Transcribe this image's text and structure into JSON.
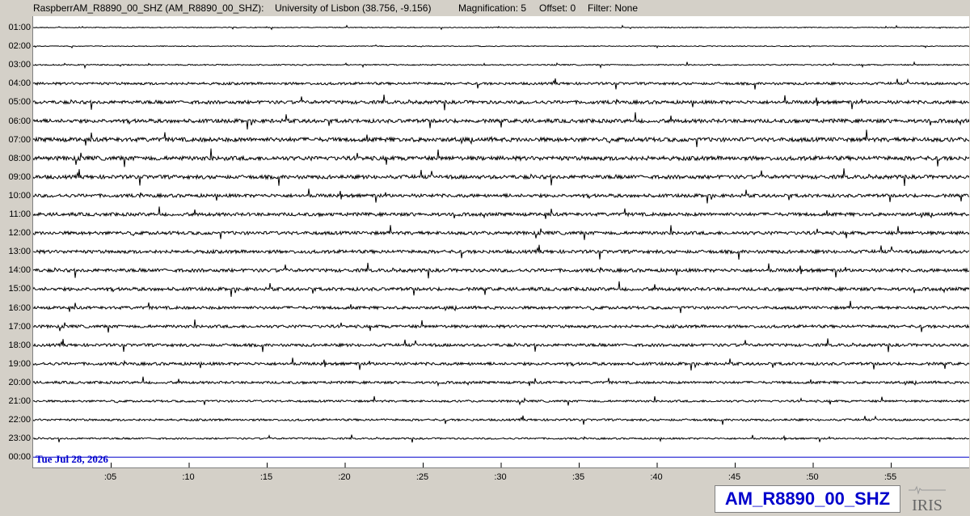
{
  "header": {
    "station": "RaspberrAM_R8890_00_SHZ (AM_R8890_00_SHZ):",
    "location": "University of Lisbon (38.756, -9.156)",
    "magnification": "Magnification: 5",
    "offset": "Offset: 0",
    "filter": "Filter: None"
  },
  "rows": [
    "01:00",
    "02:00",
    "03:00",
    "04:00",
    "05:00",
    "06:00",
    "07:00",
    "08:00",
    "09:00",
    "10:00",
    "11:00",
    "12:00",
    "13:00",
    "14:00",
    "15:00",
    "16:00",
    "17:00",
    "18:00",
    "19:00",
    "20:00",
    "21:00",
    "22:00",
    "23:00",
    "00:00"
  ],
  "x_ticks": [
    ":05",
    ":10",
    ":15",
    ":20",
    ":25",
    ":30",
    ":35",
    ":40",
    ":45",
    ":50",
    ":55"
  ],
  "date_label": "Tue Jul 28, 2026",
  "station_name": "AM_R8890_00_SHZ",
  "logo_text": "IRIS",
  "colors": {
    "trace": "#000000",
    "current_line": "#0000cc",
    "label_blue": "#0000cc",
    "background": "#d4d0c8"
  },
  "chart_data": {
    "type": "line",
    "x_unit": "minutes",
    "xlim": [
      0,
      60
    ],
    "x_ticks": [
      5,
      10,
      15,
      20,
      25,
      30,
      35,
      40,
      45,
      50,
      55
    ],
    "row_labels": [
      "01:00",
      "02:00",
      "03:00",
      "04:00",
      "05:00",
      "06:00",
      "07:00",
      "08:00",
      "09:00",
      "10:00",
      "11:00",
      "12:00",
      "13:00",
      "14:00",
      "15:00",
      "16:00",
      "17:00",
      "18:00",
      "19:00",
      "20:00",
      "21:00",
      "22:00",
      "23:00",
      "00:00"
    ],
    "noise_level": [
      1,
      1,
      1.5,
      3,
      4,
      4.5,
      5,
      5,
      4.5,
      4,
      4,
      4,
      4,
      4,
      4,
      3.5,
      3.5,
      3.5,
      3.5,
      3,
      2.5,
      2.5,
      2,
      0
    ],
    "grid": false,
    "legend": "none"
  }
}
